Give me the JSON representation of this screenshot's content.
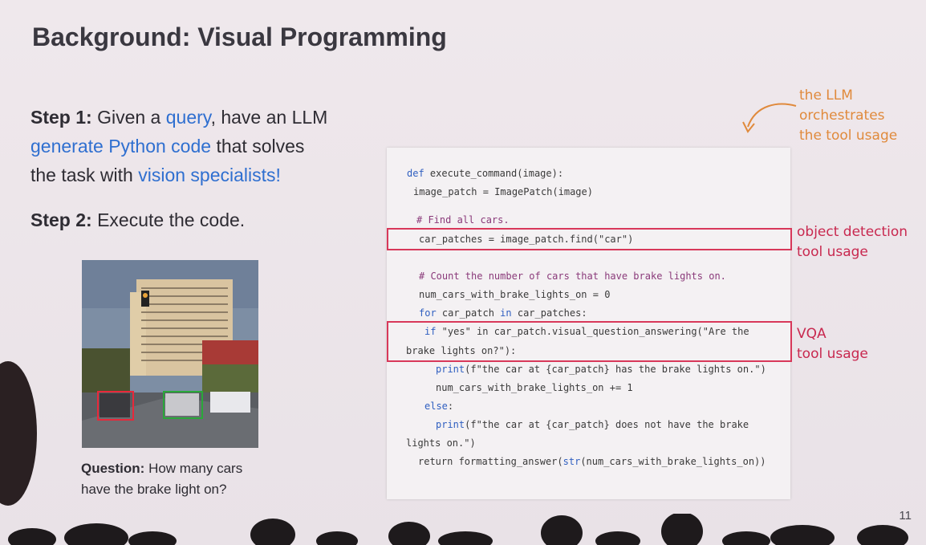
{
  "title": "Background: Visual Programming",
  "step1": {
    "label": "Step 1:",
    "t1": " Given a ",
    "query": "query",
    "t2": ", have an LLM",
    "gen": "generate Python code",
    "t3": " that solves",
    "t4": "the task with ",
    "vision": "vision specialists!"
  },
  "step2": {
    "label": "Step 2:",
    "text": " Execute the code."
  },
  "caption": {
    "label": "Question:",
    "line1": " How many cars",
    "line2": "have the brake light on?"
  },
  "code": {
    "l1_kw": "def",
    "l1": " execute_command(image):",
    "l2": "image_patch = ImagePatch(image)",
    "l3": "# Find all cars.",
    "l4": "car_patches = image_patch.find(\"car\")",
    "l5": "# Count the number of cars that have brake lights on.",
    "l6": "num_cars_with_brake_lights_on = 0",
    "l7_kw": "for",
    "l7a": " car_patch ",
    "l7_kw2": "in",
    "l7b": " car_patches:",
    "l8_kw": "if",
    "l8": " \"yes\" in car_patch.visual_question_answering(\"Are the",
    "l9": "brake lights on?\"):",
    "l10_kw": "print",
    "l10": "(f\"the car at {car_patch} has the brake lights on.\")",
    "l11": "num_cars_with_brake_lights_on += 1",
    "l12_kw": "else",
    "l12": ":",
    "l13_kw": "print",
    "l13": "(f\"the car at {car_patch} does not have the brake",
    "l14": "lights on.\")",
    "l15": "return formatting_answer(",
    "l15_kw": "str",
    "l15b": "(num_cars_with_brake_lights_on))"
  },
  "notes": {
    "orchestrates": [
      "the LLM",
      "orchestrates",
      "the tool usage"
    ],
    "detection": [
      "object detection",
      "tool usage"
    ],
    "vqa": [
      "VQA",
      "tool usage"
    ]
  },
  "page_number": "11",
  "colors": {
    "accent_blue": "#2f6fd0",
    "annotation_red": "#d8385a",
    "annotation_orange": "#e08a3c"
  }
}
